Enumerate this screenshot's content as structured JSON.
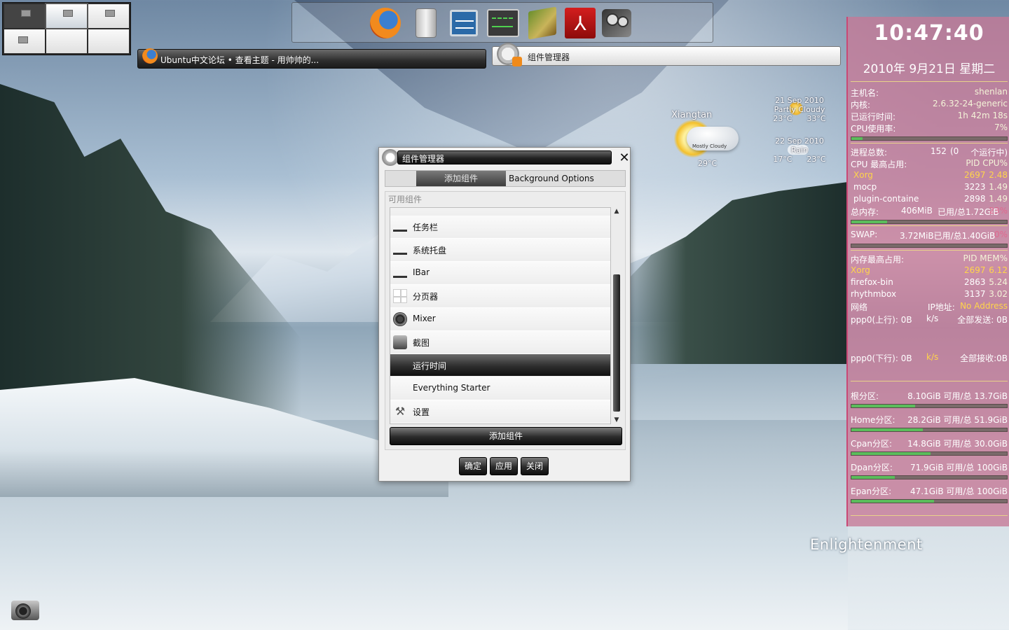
{
  "pager": {
    "desktops": 6,
    "active": 1
  },
  "dock": {
    "items": [
      {
        "name": "firefox-icon"
      },
      {
        "name": "disk-utility-icon"
      },
      {
        "name": "system-monitor-icon"
      },
      {
        "name": "activity-monitor-icon"
      },
      {
        "name": "dictionary-book-icon"
      },
      {
        "name": "pdf-reader-icon",
        "glyph": "⅄"
      },
      {
        "name": "video-player-icon"
      }
    ]
  },
  "taskbar": {
    "firefox_window": "Ubuntu中文论坛 • 查看主题 - 用帅帅的...",
    "gadget_manager_window": "组件管理器"
  },
  "weather": {
    "city": "Xiangtan",
    "condition": "Mostly Cloudy",
    "temp": "29°C",
    "forecast": [
      {
        "date": "21 Sep 2010",
        "cond": "Partly Cloudy",
        "low": "23°C",
        "high": "33°C"
      },
      {
        "date": "22 Sep 2010",
        "cond": "Rain",
        "low": "17°C",
        "high": "23°C"
      }
    ]
  },
  "conky": {
    "time": "10:47:40",
    "date": "2010年 9月21日 星期二",
    "host_label": "主机名:",
    "host": "shenlan",
    "kernel_label": "内核:",
    "kernel": "2.6.32-24-generic",
    "uptime_label": "已运行时间:",
    "uptime": "1h 42m 18s",
    "cpu_label": "CPU使用率:",
    "cpu": "7%",
    "cpu_frac": 0.07,
    "proc_label": "进程总数:",
    "proc_count": "152",
    "proc_running": "(0",
    "proc_running_label": "个运行中)",
    "cpu_top_label": "CPU 最高占用:",
    "cpu_top_cols": "PID CPU%",
    "cpu_top": [
      {
        "name": "Xorg",
        "pid": "2697",
        "val": "2.48"
      },
      {
        "name": "mocp",
        "pid": "3223",
        "val": "1.49"
      },
      {
        "name": "plugin-containe",
        "pid": "2898",
        "val": "1.49"
      }
    ],
    "mem_label": "总内存:",
    "mem_used": "406MiB",
    "mem_sep": "已用/总1.72GiB",
    "mem_pct": "23%",
    "mem_frac": 0.23,
    "swap_label": "SWAP:",
    "swap_val": "3.72MiB已用/总1.40GiB",
    "swap_pct": "0%",
    "swap_frac": 0.0,
    "mem_top_label": "内存最高占用:",
    "mem_top_cols": "PID MEM%",
    "mem_top": [
      {
        "name": "Xorg",
        "pid": "2697",
        "val": "6.12"
      },
      {
        "name": "firefox-bin",
        "pid": "2863",
        "val": "5.24"
      },
      {
        "name": "rhythmbox",
        "pid": "3137",
        "val": "3.02"
      }
    ],
    "net_label": "网络",
    "ip_label": "IP地址:",
    "ip": "No Address",
    "up_label": "ppp0(上行): 0B",
    "up_unit": "k/s",
    "up_total": "全部发送: 0B",
    "down_label": "ppp0(下行): 0B",
    "down_unit": "k/s",
    "down_total": "全部接收:0B",
    "disks": [
      {
        "label": "根分区:",
        "value": "8.10GiB 可用/总 13.7GiB",
        "used_frac": 0.41
      },
      {
        "label": "Home分区:",
        "value": "28.2GiB 可用/总 51.9GiB",
        "used_frac": 0.46
      },
      {
        "label": "Cpan分区:",
        "value": "14.8GiB 可用/总 30.0GiB",
        "used_frac": 0.51
      },
      {
        "label": "Dpan分区:",
        "value": "71.9GiB 可用/总 100GiB",
        "used_frac": 0.28
      },
      {
        "label": "Epan分区:",
        "value": "47.1GiB 可用/总 100GiB",
        "used_frac": 0.53
      }
    ]
  },
  "logo": "Enlightenment",
  "dialog": {
    "title": "组件管理器",
    "tab_active": "添加组件",
    "tab_other": "Background Options",
    "group_label": "可用组件",
    "items": [
      {
        "label": "任务栏",
        "icon": "taskbar-icon"
      },
      {
        "label": "系统托盘",
        "icon": "systray-icon"
      },
      {
        "label": "IBar",
        "icon": "ibar-icon"
      },
      {
        "label": "分页器",
        "icon": "pager-icon"
      },
      {
        "label": "Mixer",
        "icon": "mixer-icon"
      },
      {
        "label": "截图",
        "icon": "screenshot-icon"
      },
      {
        "label": "运行时间",
        "icon": "runtime-icon",
        "selected": true
      },
      {
        "label": "Everything Starter",
        "icon": "everything-icon"
      },
      {
        "label": "设置",
        "icon": "settings-wrench-icon"
      }
    ],
    "add_button": "添加组件",
    "ok": "确定",
    "apply": "应用",
    "close": "关闭"
  }
}
